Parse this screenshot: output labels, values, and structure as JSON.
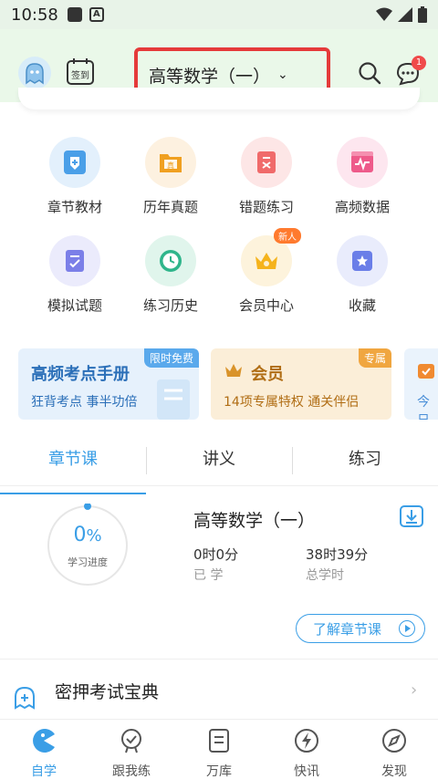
{
  "status_bar": {
    "time": "10:58"
  },
  "header": {
    "course_title": "高等数学（一）",
    "calendar_label": "签到",
    "message_badge": "1"
  },
  "grid": [
    {
      "label": "章节教材",
      "icon": "textbook-icon",
      "color": "#4a9fe8"
    },
    {
      "label": "历年真题",
      "icon": "past-exam-icon",
      "color": "#f0a020"
    },
    {
      "label": "错题练习",
      "icon": "wrong-question-icon",
      "color": "#f06a6a"
    },
    {
      "label": "高频数据",
      "icon": "high-frequency-icon",
      "color": "#ee5a8a"
    },
    {
      "label": "模拟试题",
      "icon": "mock-test-icon",
      "color": "#7b7fe8"
    },
    {
      "label": "练习历史",
      "icon": "history-clock-icon",
      "color": "#2fb58b"
    },
    {
      "label": "会员中心",
      "icon": "crown-icon",
      "color": "#f5b31c",
      "tag": "新人"
    },
    {
      "label": "收藏",
      "icon": "favorite-icon",
      "color": "#6a7ee8"
    }
  ],
  "banners": [
    {
      "title": "高频考点手册",
      "sub": "狂背考点 事半功倍",
      "tag": "限时免费"
    },
    {
      "title": "会员",
      "sub": "14项专属特权 通关伴侣",
      "tag": "专属"
    },
    {
      "sub": "今日"
    }
  ],
  "tabs": [
    "章节课",
    "讲义",
    "练习"
  ],
  "progress": {
    "percent": "0",
    "percent_sign": "%",
    "label": "学习进度",
    "course_name": "高等数学（一）",
    "studied_value": "0时0分",
    "studied_label": "已 学",
    "total_value": "38时39分",
    "total_label": "总学时",
    "learn_button": "了解章节课"
  },
  "vault": {
    "title": "密押考试宝典"
  },
  "bottom_nav": [
    {
      "label": "自学",
      "active": true
    },
    {
      "label": "跟我练"
    },
    {
      "label": "万库"
    },
    {
      "label": "快讯"
    },
    {
      "label": "发现"
    }
  ]
}
